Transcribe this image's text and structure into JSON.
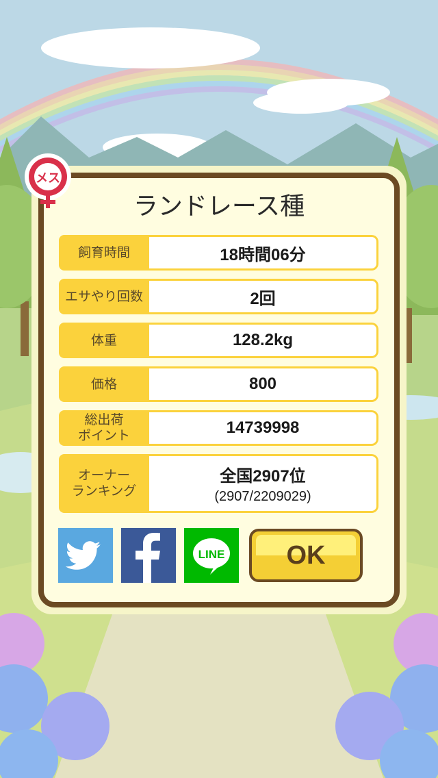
{
  "dialog": {
    "title": "ランドレース種",
    "gender_badge_text": "メス",
    "rows": [
      {
        "label": "飼育時間",
        "value": "18時間06分"
      },
      {
        "label": "エサやり回数",
        "value": "2回"
      },
      {
        "label": "体重",
        "value": "128.2kg"
      },
      {
        "label": "価格",
        "value": "800"
      },
      {
        "label": "総出荷\nポイント",
        "value": "14739998"
      },
      {
        "label": "オーナー\nランキング",
        "value": "全国2907位",
        "sub": "(2907/2209029)"
      }
    ],
    "share": {
      "line_label": "LINE"
    },
    "ok_label": "OK"
  },
  "icons": [
    "female-gender-icon",
    "twitter-bird-icon",
    "facebook-f-icon",
    "line-chat-icon"
  ],
  "colors": {
    "panel_border": "#6b4a23",
    "label_bg": "#fbd23c",
    "ok_button": "#f4cf35",
    "twitter": "#5aa8e0",
    "facebook": "#3b5998",
    "line": "#00b900",
    "badge": "#d9304a"
  }
}
